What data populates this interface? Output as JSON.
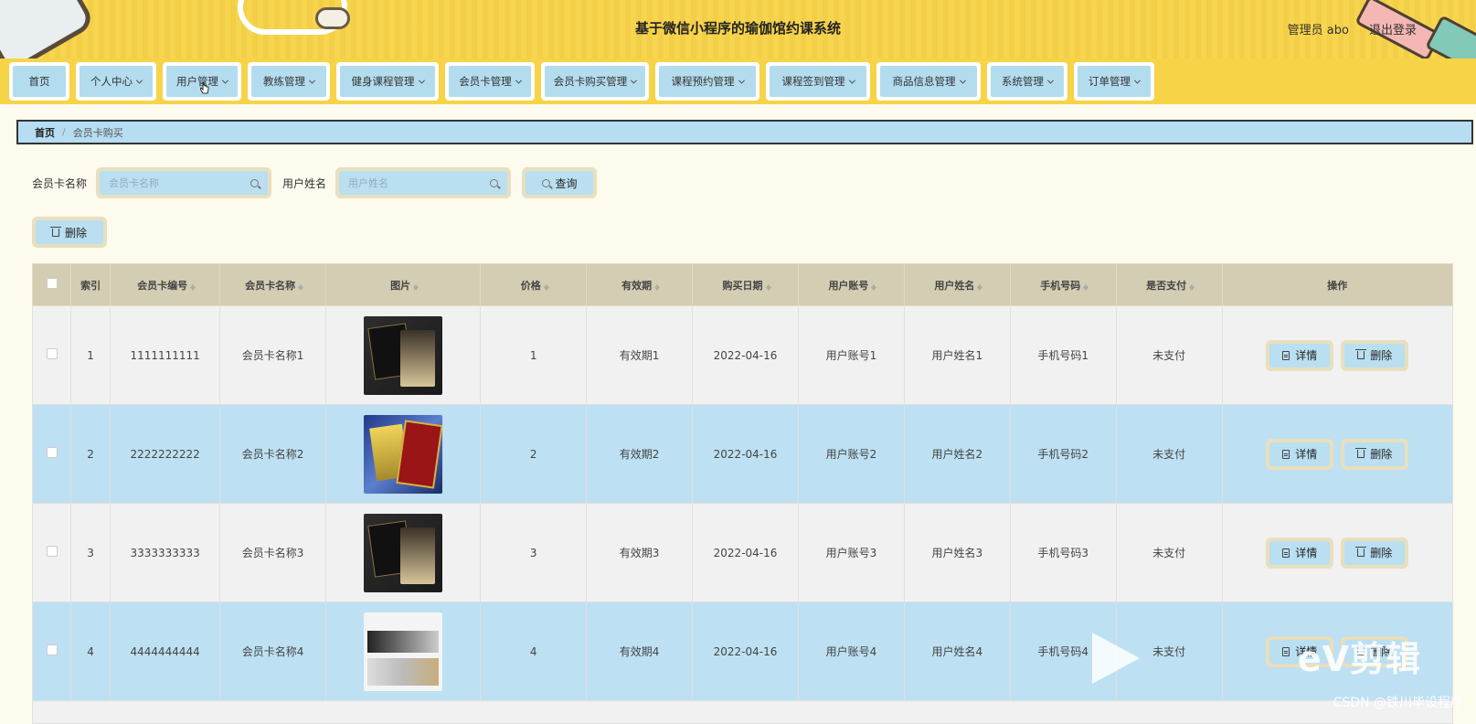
{
  "header": {
    "title": "基于微信小程序的瑜伽馆约课系统",
    "user_label": "管理员 abo",
    "logout_label": "退出登录"
  },
  "nav": [
    {
      "label": "首页",
      "has_dropdown": false
    },
    {
      "label": "个人中心",
      "has_dropdown": true
    },
    {
      "label": "用户管理",
      "has_dropdown": true
    },
    {
      "label": "教练管理",
      "has_dropdown": true
    },
    {
      "label": "健身课程管理",
      "has_dropdown": true
    },
    {
      "label": "会员卡管理",
      "has_dropdown": true
    },
    {
      "label": "会员卡购买管理",
      "has_dropdown": true
    },
    {
      "label": "课程预约管理",
      "has_dropdown": true
    },
    {
      "label": "课程签到管理",
      "has_dropdown": true
    },
    {
      "label": "商品信息管理",
      "has_dropdown": true
    },
    {
      "label": "系统管理",
      "has_dropdown": true
    },
    {
      "label": "订单管理",
      "has_dropdown": true
    }
  ],
  "breadcrumb": {
    "home": "首页",
    "separator": "/",
    "current": "会员卡购买"
  },
  "search": {
    "card_name_label": "会员卡名称",
    "card_name_placeholder": "会员卡名称",
    "user_name_label": "用户姓名",
    "user_name_placeholder": "用户姓名",
    "query_label": "查询"
  },
  "toolbar": {
    "delete_label": "删除"
  },
  "table": {
    "headers": [
      "索引",
      "会员卡编号",
      "会员卡名称",
      "图片",
      "价格",
      "有效期",
      "购买日期",
      "用户账号",
      "用户姓名",
      "手机号码",
      "是否支付",
      "操作"
    ],
    "rows": [
      {
        "index": "1",
        "card_no": "1111111111",
        "card_name": "会员卡名称1",
        "image": "black-gold-vip-card",
        "price": "1",
        "validity": "有效期1",
        "date": "2022-04-16",
        "account": "用户账号1",
        "user_name": "用户姓名1",
        "phone": "手机号码1",
        "paid": "未支付"
      },
      {
        "index": "2",
        "card_no": "2222222222",
        "card_name": "会员卡名称2",
        "image": "gold-red-vip-card",
        "price": "2",
        "validity": "有效期2",
        "date": "2022-04-16",
        "account": "用户账号2",
        "user_name": "用户姓名2",
        "phone": "手机号码2",
        "paid": "未支付"
      },
      {
        "index": "3",
        "card_no": "3333333333",
        "card_name": "会员卡名称3",
        "image": "black-gold-vip-card",
        "price": "3",
        "validity": "有效期3",
        "date": "2022-04-16",
        "account": "用户账号3",
        "user_name": "用户姓名3",
        "phone": "手机号码3",
        "paid": "未支付"
      },
      {
        "index": "4",
        "card_no": "4444444444",
        "card_name": "会员卡名称4",
        "image": "silver-card-set",
        "price": "4",
        "validity": "有效期4",
        "date": "2022-04-16",
        "account": "用户账号4",
        "user_name": "用户姓名4",
        "phone": "手机号码4",
        "paid": "未支付"
      }
    ],
    "detail_label": "详情",
    "delete_label": "删除"
  },
  "watermark": {
    "brand": "eV剪辑",
    "credit": "CSDN @铁川毕设程序"
  },
  "colors": {
    "header_bg": "#f7d348",
    "button_bg": "#b9dff1",
    "button_border": "#e8dfbe",
    "row_highlight": "#bde0f2",
    "header_row": "#d3cdb3"
  }
}
